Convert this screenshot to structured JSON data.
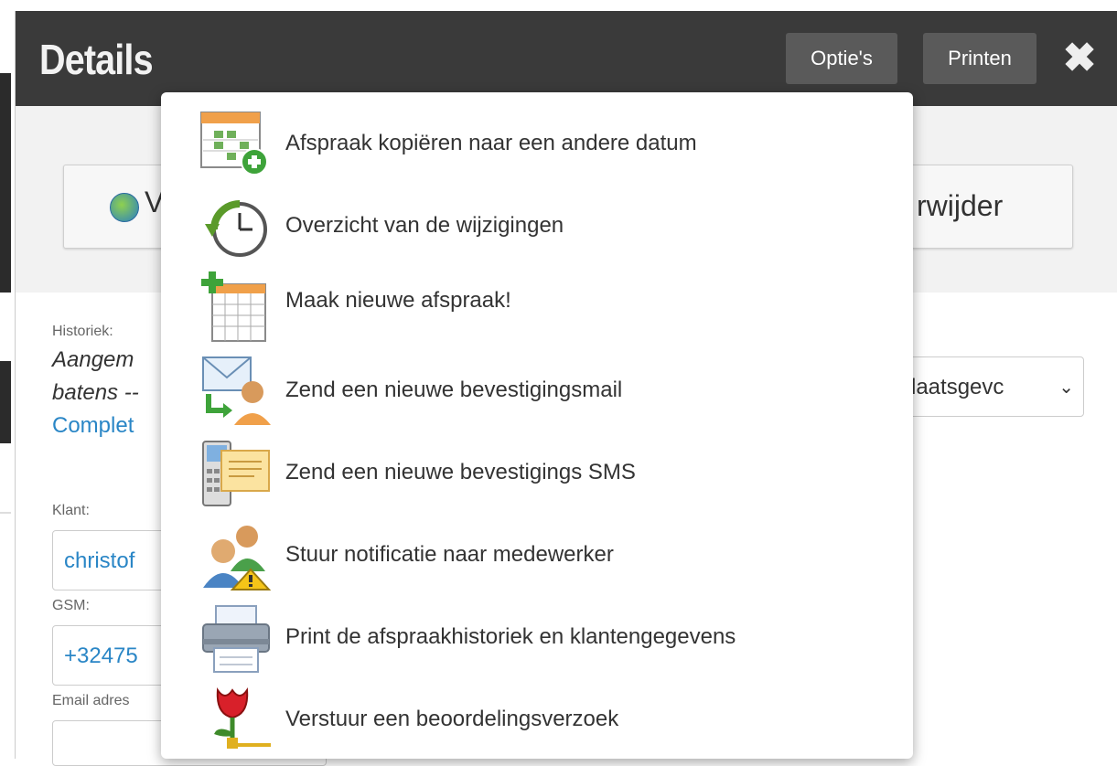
{
  "modal": {
    "title": "Details",
    "options_button": "Optie's",
    "print_button": "Printen",
    "close_icon": "close-icon"
  },
  "actions": {
    "left_button_text": "V",
    "right_button_text": "rwijder"
  },
  "form": {
    "history_label": "Historiek:",
    "history_line1": "Aangem",
    "history_line2": "batens --",
    "history_link": "Complet",
    "client_label": "Klant:",
    "client_value": "christof",
    "gsm_label": "GSM:",
    "gsm_value": "+32475",
    "email_label": "Email adres",
    "status_select": "laatsgevc"
  },
  "menu": {
    "items": [
      {
        "label": "Afspraak kopiëren naar een andere datum",
        "icon": "calendar-copy-icon"
      },
      {
        "label": "Overzicht van de wijzigingen",
        "icon": "clock-history-icon"
      },
      {
        "label": "Maak nieuwe afspraak!",
        "icon": "calendar-add-icon"
      },
      {
        "label": "Zend een nieuwe bevestigingsmail",
        "icon": "mail-user-icon"
      },
      {
        "label": "Zend een nieuwe bevestigings SMS",
        "icon": "phone-sms-icon"
      },
      {
        "label": "Stuur notificatie naar medewerker",
        "icon": "users-warning-icon"
      },
      {
        "label": "Print de afspraakhistoriek en klantengegevens",
        "icon": "printer-icon"
      },
      {
        "label": "Verstuur een beoordelingsverzoek",
        "icon": "tulip-review-icon"
      }
    ]
  },
  "colors": {
    "header_bg": "#3a3a3a",
    "button_bg": "#5a5a5a",
    "link": "#2a86c6"
  }
}
